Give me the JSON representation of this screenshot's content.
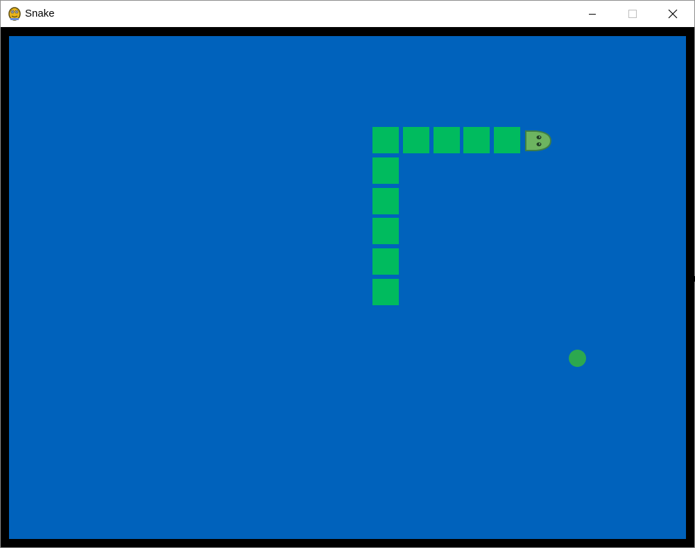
{
  "window": {
    "title": "Snake",
    "icon": "pygame-snake-icon",
    "controls": [
      "minimize-icon",
      "maximize-icon",
      "close-icon"
    ]
  },
  "colors": {
    "frame": "#000000",
    "board": "#0062BC",
    "snake_body": "#00BB5E",
    "snake_head": "#6DB460",
    "snake_head_outline": "#3E7E46",
    "food": "#2CA84F"
  },
  "game": {
    "snake": {
      "head": {
        "col": 17,
        "row": 3,
        "direction": "right"
      },
      "body": [
        {
          "col": 16,
          "row": 3
        },
        {
          "col": 15,
          "row": 3
        },
        {
          "col": 14,
          "row": 3
        },
        {
          "col": 13,
          "row": 3
        },
        {
          "col": 12,
          "row": 3
        },
        {
          "col": 12,
          "row": 4
        },
        {
          "col": 12,
          "row": 5
        },
        {
          "col": 12,
          "row": 6
        },
        {
          "col": 12,
          "row": 7
        },
        {
          "col": 12,
          "row": 8
        }
      ]
    },
    "food": {
      "col": 18,
      "row": 9
    }
  }
}
